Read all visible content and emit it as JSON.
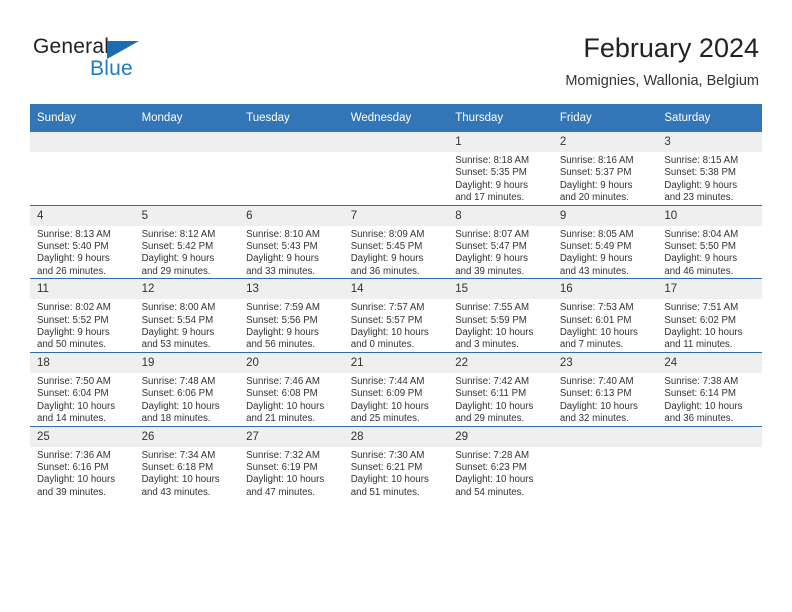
{
  "brand": {
    "name_top": "General",
    "name_bottom": "Blue",
    "triangle_color": "#1b6cb3",
    "blue_color": "#1b7ccb"
  },
  "header": {
    "title": "February 2024",
    "location": "Momignies, Wallonia, Belgium"
  },
  "theme": {
    "header_blue": "#3376b8",
    "row_rule_blue": "#2e6da8",
    "daynum_band": "#efefef"
  },
  "weekday_headers": [
    "Sunday",
    "Monday",
    "Tuesday",
    "Wednesday",
    "Thursday",
    "Friday",
    "Saturday"
  ],
  "weeks": [
    [
      {
        "day": "",
        "lines": []
      },
      {
        "day": "",
        "lines": []
      },
      {
        "day": "",
        "lines": []
      },
      {
        "day": "",
        "lines": []
      },
      {
        "day": "1",
        "lines": [
          "Sunrise: 8:18 AM",
          "Sunset: 5:35 PM",
          "Daylight: 9 hours",
          "and 17 minutes."
        ]
      },
      {
        "day": "2",
        "lines": [
          "Sunrise: 8:16 AM",
          "Sunset: 5:37 PM",
          "Daylight: 9 hours",
          "and 20 minutes."
        ]
      },
      {
        "day": "3",
        "lines": [
          "Sunrise: 8:15 AM",
          "Sunset: 5:38 PM",
          "Daylight: 9 hours",
          "and 23 minutes."
        ]
      }
    ],
    [
      {
        "day": "4",
        "lines": [
          "Sunrise: 8:13 AM",
          "Sunset: 5:40 PM",
          "Daylight: 9 hours",
          "and 26 minutes."
        ]
      },
      {
        "day": "5",
        "lines": [
          "Sunrise: 8:12 AM",
          "Sunset: 5:42 PM",
          "Daylight: 9 hours",
          "and 29 minutes."
        ]
      },
      {
        "day": "6",
        "lines": [
          "Sunrise: 8:10 AM",
          "Sunset: 5:43 PM",
          "Daylight: 9 hours",
          "and 33 minutes."
        ]
      },
      {
        "day": "7",
        "lines": [
          "Sunrise: 8:09 AM",
          "Sunset: 5:45 PM",
          "Daylight: 9 hours",
          "and 36 minutes."
        ]
      },
      {
        "day": "8",
        "lines": [
          "Sunrise: 8:07 AM",
          "Sunset: 5:47 PM",
          "Daylight: 9 hours",
          "and 39 minutes."
        ]
      },
      {
        "day": "9",
        "lines": [
          "Sunrise: 8:05 AM",
          "Sunset: 5:49 PM",
          "Daylight: 9 hours",
          "and 43 minutes."
        ]
      },
      {
        "day": "10",
        "lines": [
          "Sunrise: 8:04 AM",
          "Sunset: 5:50 PM",
          "Daylight: 9 hours",
          "and 46 minutes."
        ]
      }
    ],
    [
      {
        "day": "11",
        "lines": [
          "Sunrise: 8:02 AM",
          "Sunset: 5:52 PM",
          "Daylight: 9 hours",
          "and 50 minutes."
        ]
      },
      {
        "day": "12",
        "lines": [
          "Sunrise: 8:00 AM",
          "Sunset: 5:54 PM",
          "Daylight: 9 hours",
          "and 53 minutes."
        ]
      },
      {
        "day": "13",
        "lines": [
          "Sunrise: 7:59 AM",
          "Sunset: 5:56 PM",
          "Daylight: 9 hours",
          "and 56 minutes."
        ]
      },
      {
        "day": "14",
        "lines": [
          "Sunrise: 7:57 AM",
          "Sunset: 5:57 PM",
          "Daylight: 10 hours",
          "and 0 minutes."
        ]
      },
      {
        "day": "15",
        "lines": [
          "Sunrise: 7:55 AM",
          "Sunset: 5:59 PM",
          "Daylight: 10 hours",
          "and 3 minutes."
        ]
      },
      {
        "day": "16",
        "lines": [
          "Sunrise: 7:53 AM",
          "Sunset: 6:01 PM",
          "Daylight: 10 hours",
          "and 7 minutes."
        ]
      },
      {
        "day": "17",
        "lines": [
          "Sunrise: 7:51 AM",
          "Sunset: 6:02 PM",
          "Daylight: 10 hours",
          "and 11 minutes."
        ]
      }
    ],
    [
      {
        "day": "18",
        "lines": [
          "Sunrise: 7:50 AM",
          "Sunset: 6:04 PM",
          "Daylight: 10 hours",
          "and 14 minutes."
        ]
      },
      {
        "day": "19",
        "lines": [
          "Sunrise: 7:48 AM",
          "Sunset: 6:06 PM",
          "Daylight: 10 hours",
          "and 18 minutes."
        ]
      },
      {
        "day": "20",
        "lines": [
          "Sunrise: 7:46 AM",
          "Sunset: 6:08 PM",
          "Daylight: 10 hours",
          "and 21 minutes."
        ]
      },
      {
        "day": "21",
        "lines": [
          "Sunrise: 7:44 AM",
          "Sunset: 6:09 PM",
          "Daylight: 10 hours",
          "and 25 minutes."
        ]
      },
      {
        "day": "22",
        "lines": [
          "Sunrise: 7:42 AM",
          "Sunset: 6:11 PM",
          "Daylight: 10 hours",
          "and 29 minutes."
        ]
      },
      {
        "day": "23",
        "lines": [
          "Sunrise: 7:40 AM",
          "Sunset: 6:13 PM",
          "Daylight: 10 hours",
          "and 32 minutes."
        ]
      },
      {
        "day": "24",
        "lines": [
          "Sunrise: 7:38 AM",
          "Sunset: 6:14 PM",
          "Daylight: 10 hours",
          "and 36 minutes."
        ]
      }
    ],
    [
      {
        "day": "25",
        "lines": [
          "Sunrise: 7:36 AM",
          "Sunset: 6:16 PM",
          "Daylight: 10 hours",
          "and 39 minutes."
        ]
      },
      {
        "day": "26",
        "lines": [
          "Sunrise: 7:34 AM",
          "Sunset: 6:18 PM",
          "Daylight: 10 hours",
          "and 43 minutes."
        ]
      },
      {
        "day": "27",
        "lines": [
          "Sunrise: 7:32 AM",
          "Sunset: 6:19 PM",
          "Daylight: 10 hours",
          "and 47 minutes."
        ]
      },
      {
        "day": "28",
        "lines": [
          "Sunrise: 7:30 AM",
          "Sunset: 6:21 PM",
          "Daylight: 10 hours",
          "and 51 minutes."
        ]
      },
      {
        "day": "29",
        "lines": [
          "Sunrise: 7:28 AM",
          "Sunset: 6:23 PM",
          "Daylight: 10 hours",
          "and 54 minutes."
        ]
      },
      {
        "day": "",
        "lines": []
      },
      {
        "day": "",
        "lines": []
      }
    ]
  ]
}
